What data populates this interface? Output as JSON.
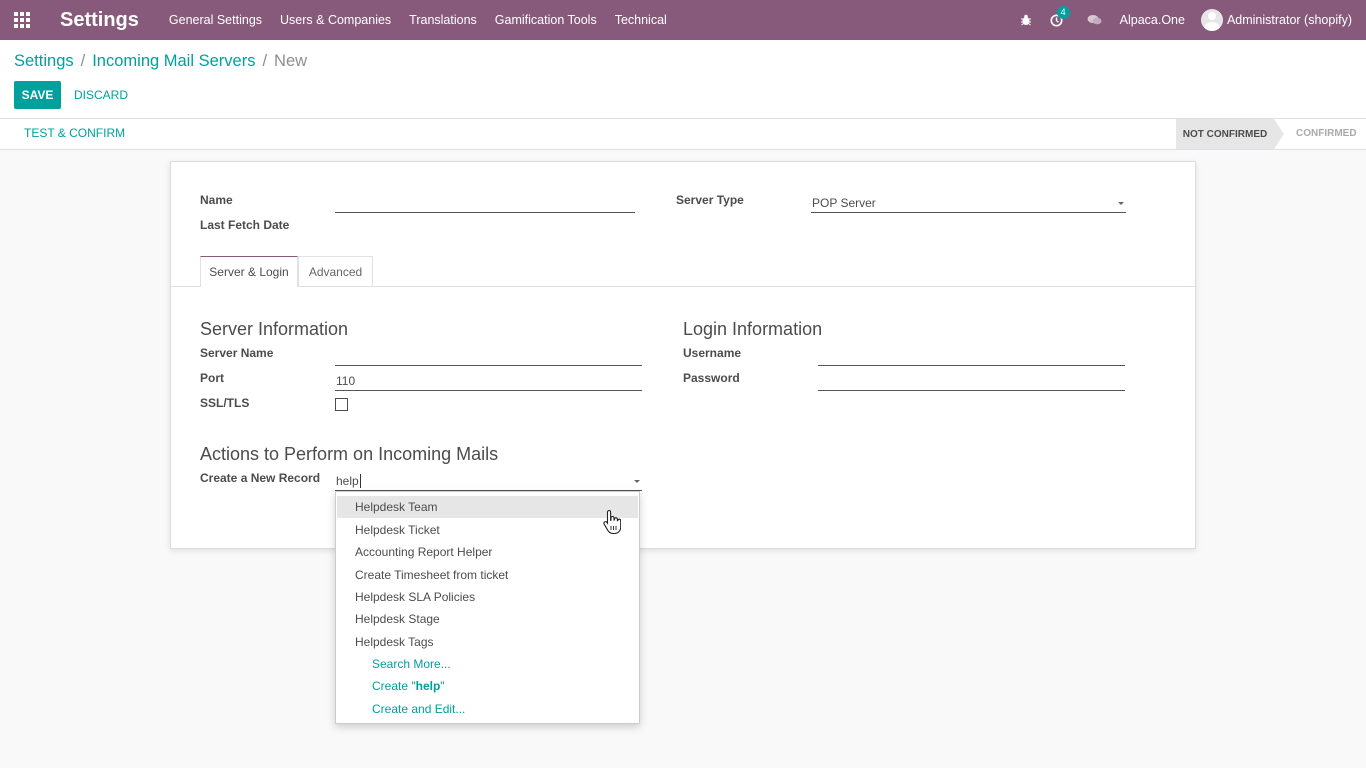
{
  "navbar": {
    "apps_icon": "apps-grid-icon",
    "brand": "Settings",
    "menu": [
      "General Settings",
      "Users & Companies",
      "Translations",
      "Gamification Tools",
      "Technical"
    ],
    "activity_badge": "4",
    "company": "Alpaca.One",
    "user": "Administrator (shopify)",
    "colors": {
      "primary": "#875a7b",
      "accent": "#00a09d"
    }
  },
  "breadcrumb": {
    "root": "Settings",
    "parent": "Incoming Mail Servers",
    "current": "New",
    "separator": "/"
  },
  "buttons": {
    "save": "SAVE",
    "discard": "DISCARD",
    "test_confirm": "TEST & CONFIRM"
  },
  "statusbar": {
    "active_stage": "NOT CONFIRMED",
    "next_stage": "CONFIRMED"
  },
  "form": {
    "name_label": "Name",
    "name_value": "",
    "last_fetch_label": "Last Fetch Date",
    "server_type_label": "Server Type",
    "server_type_value": "POP Server",
    "tabs": [
      "Server & Login",
      "Advanced"
    ],
    "server_info_title": "Server Information",
    "server_name_label": "Server Name",
    "server_name_value": "",
    "port_label": "Port",
    "port_value": "110",
    "ssl_label": "SSL/TLS",
    "ssl_checked": false,
    "login_info_title": "Login Information",
    "username_label": "Username",
    "username_value": "",
    "password_label": "Password",
    "password_value": "",
    "actions_title": "Actions to Perform on Incoming Mails",
    "create_record_label": "Create a New Record",
    "create_record_value": "help"
  },
  "dropdown": {
    "items": [
      "Helpdesk Team",
      "Helpdesk Ticket",
      "Accounting Report Helper",
      "Create Timesheet from ticket",
      "Helpdesk SLA Policies",
      "Helpdesk Stage",
      "Helpdesk Tags"
    ],
    "search_more": "Search More...",
    "create_prefix": "Create \"",
    "create_term": "help",
    "create_suffix": "\"",
    "create_edit": "Create and Edit..."
  }
}
